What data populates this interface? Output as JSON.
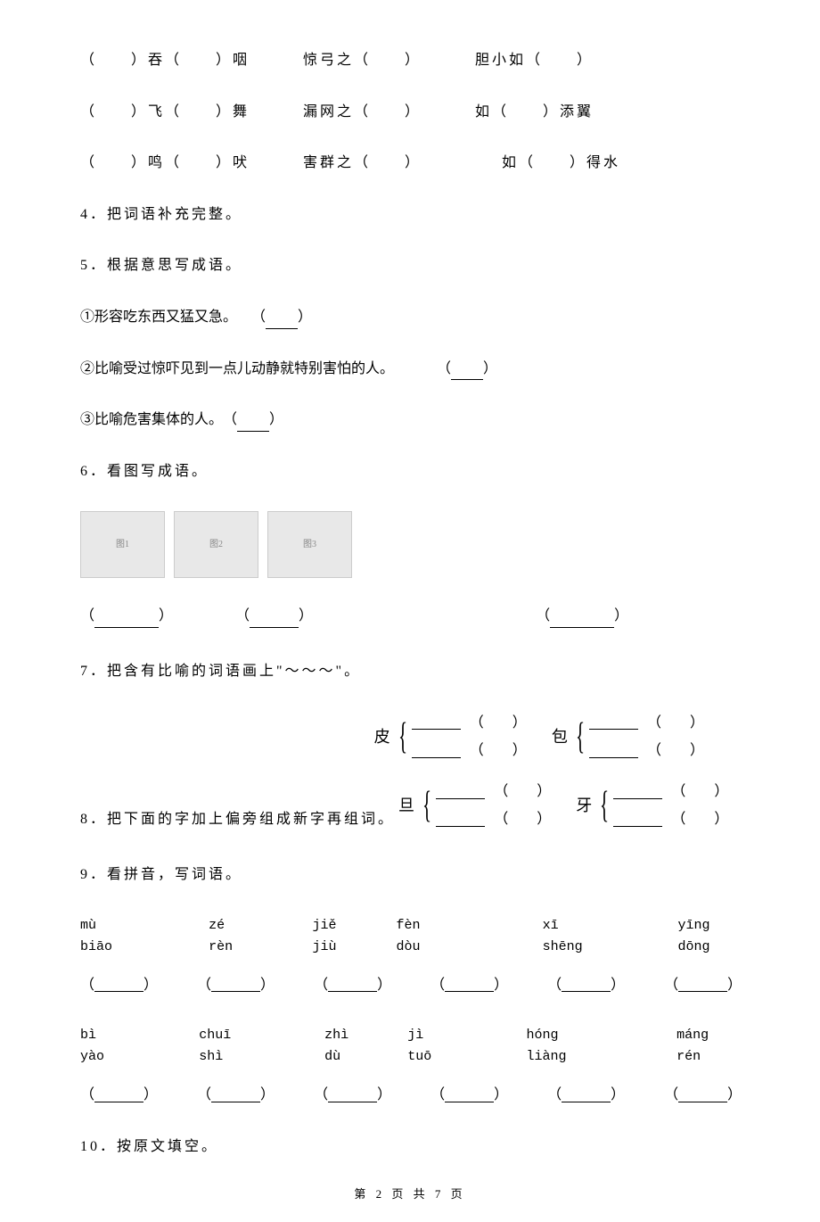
{
  "idioms": {
    "row1": [
      {
        "pattern": "（　　）吞（　　）咽"
      },
      {
        "pattern": "惊弓之（　　）"
      },
      {
        "pattern": "胆小如（　　）"
      }
    ],
    "row2": [
      {
        "pattern": "（　　）飞（　　）舞"
      },
      {
        "pattern": "漏网之（　　）"
      },
      {
        "pattern": "如（　　）添翼"
      }
    ],
    "row3": [
      {
        "pattern": "（　　）鸣（　　）吠"
      },
      {
        "pattern": "害群之（　　）"
      },
      {
        "pattern": "如（　　）得水"
      }
    ]
  },
  "q4": "4．把词语补充完整。",
  "q5": {
    "title": "5．根据意思写成语。",
    "items": [
      "①形容吃东西又猛又急。　　（",
      "②比喻受过惊吓见到一点儿动静就特别害怕的人。　　　　（",
      "③比喻危害集体的人。　（"
    ],
    "close": "）"
  },
  "q6": {
    "title": "6．看图写成语。",
    "imgPlaceholders": [
      "图1",
      "图2",
      "图3"
    ],
    "answerPrefix": "（",
    "answerSuffix": "）"
  },
  "q7": "7．把含有比喻的词语画上\"～～～\"。",
  "q8": {
    "title": "8．把下面的字加上偏旁组成新字再组词。",
    "chars": [
      "皮",
      "包",
      "旦",
      "牙"
    ],
    "paren": "（　　）"
  },
  "q9": {
    "title": "9．看拼音，写词语。",
    "row1_pinyin": [
      "mù biāo",
      "zé rèn",
      "jiě jiù",
      "fèn dòu",
      "xī shēng",
      "yīng dōng"
    ],
    "row2_pinyin": [
      "bì yào",
      "chuī shì",
      "zhì dù",
      "jì tuō",
      "hóng liàng",
      "máng rén"
    ],
    "blank_paren_open": "（",
    "blank_paren_close": "）"
  },
  "q10": "10．按原文填空。",
  "pageNum": "第 2 页 共 7 页"
}
